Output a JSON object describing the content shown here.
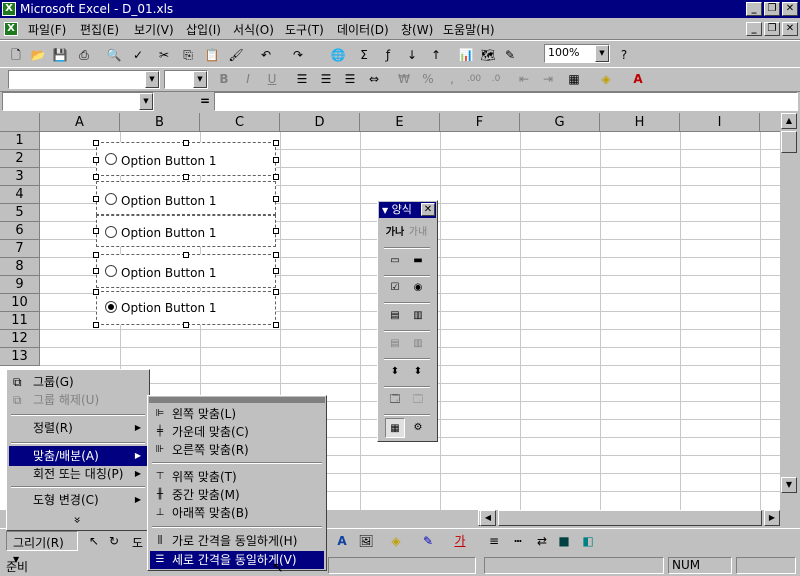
{
  "window": {
    "title": "Microsoft Excel - D_01.xls"
  },
  "menu": [
    "파일(F)",
    "편집(E)",
    "보기(V)",
    "삽입(I)",
    "서식(O)",
    "도구(T)",
    "데이터(D)",
    "창(W)",
    "도움말(H)"
  ],
  "toolbar": {
    "zoom": "100%"
  },
  "formula_bar": {
    "equals": "="
  },
  "grid": {
    "columns": [
      "A",
      "B",
      "C",
      "D",
      "E",
      "F",
      "G",
      "H",
      "I"
    ],
    "rows": [
      "1",
      "2",
      "3",
      "4",
      "5",
      "6",
      "7",
      "8",
      "9",
      "10",
      "11",
      "12",
      "13"
    ]
  },
  "option_buttons": [
    {
      "label": "Option Button 1",
      "selected": false
    },
    {
      "label": "Option Button 1",
      "selected": false
    },
    {
      "label": "Option Button 1",
      "selected": false
    },
    {
      "label": "Option Button 1",
      "selected": false
    },
    {
      "label": "Option Button 1",
      "selected": true
    }
  ],
  "forms_toolbar": {
    "title": "양식",
    "label_icon_text": "가나",
    "edit_icon_text": "가내"
  },
  "draw_menu": {
    "items": [
      {
        "label": "그룹(G)",
        "state": "normal"
      },
      {
        "label": "그룹 해제(U)",
        "state": "disabled"
      },
      {
        "label": "정렬(R)",
        "state": "submenu"
      },
      {
        "label": "맞춤/배분(A)",
        "state": "highlighted"
      },
      {
        "label": "회전 또는 대칭(P)",
        "state": "submenu"
      },
      {
        "label": "도형 변경(C)",
        "state": "submenu"
      }
    ],
    "more": "»"
  },
  "align_submenu": {
    "items": [
      "왼쪽 맞춤(L)",
      "가운데 맞춤(C)",
      "오른쪽 맞춤(R)",
      "위쪽 맞춤(T)",
      "중간 맞춤(M)",
      "아래쪽 맞춤(B)",
      "가로 간격을 동일하게(H)",
      "세로 간격을 동일하게(V)"
    ],
    "highlighted_index": 7
  },
  "drawing_toolbar": {
    "draw_label": "그리기(R)",
    "autoshape_fragment": "도",
    "font_color_glyph": "가"
  },
  "status": {
    "left": "준비",
    "num": "NUM"
  }
}
